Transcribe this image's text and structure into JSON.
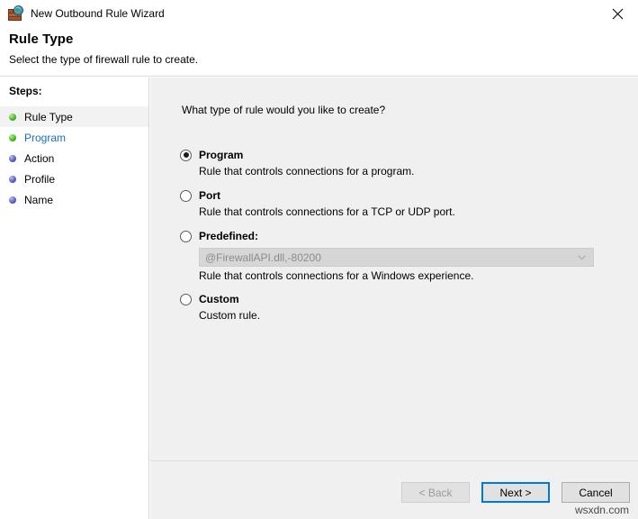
{
  "window": {
    "title": "New Outbound Rule Wizard",
    "icon": "firewall-brick-globe-icon",
    "close_label": "close-icon"
  },
  "header": {
    "title": "Rule Type",
    "subtitle": "Select the type of firewall rule to create."
  },
  "sidebar": {
    "label": "Steps:",
    "items": [
      {
        "label": "Rule Type",
        "state": "current",
        "bullet": "green"
      },
      {
        "label": "Program",
        "state": "link",
        "bullet": "green"
      },
      {
        "label": "Action",
        "state": "pending",
        "bullet": "blue"
      },
      {
        "label": "Profile",
        "state": "pending",
        "bullet": "blue"
      },
      {
        "label": "Name",
        "state": "pending",
        "bullet": "blue"
      }
    ]
  },
  "main": {
    "question": "What type of rule would you like to create?",
    "options": [
      {
        "label": "Program",
        "description": "Rule that controls connections for a program.",
        "selected": true
      },
      {
        "label": "Port",
        "description": "Rule that controls connections for a TCP or UDP port.",
        "selected": false
      },
      {
        "label": "Predefined:",
        "description": "Rule that controls connections for a Windows experience.",
        "selected": false,
        "combo_value": "@FirewallAPI.dll,-80200",
        "combo_enabled": false
      },
      {
        "label": "Custom",
        "description": "Custom rule.",
        "selected": false
      }
    ]
  },
  "footer": {
    "back_label": "< Back",
    "next_label": "Next >",
    "cancel_label": "Cancel",
    "back_disabled": true,
    "next_default": true
  },
  "watermark": "wsxdn.com",
  "colors": {
    "accent": "#0078d7",
    "link": "#1a6fbd",
    "content_bg": "#f0f0f0",
    "step_current_bg": "#f2f2f2",
    "bullet_done": "#4fbb28",
    "bullet_pending": "#5a63c8"
  }
}
